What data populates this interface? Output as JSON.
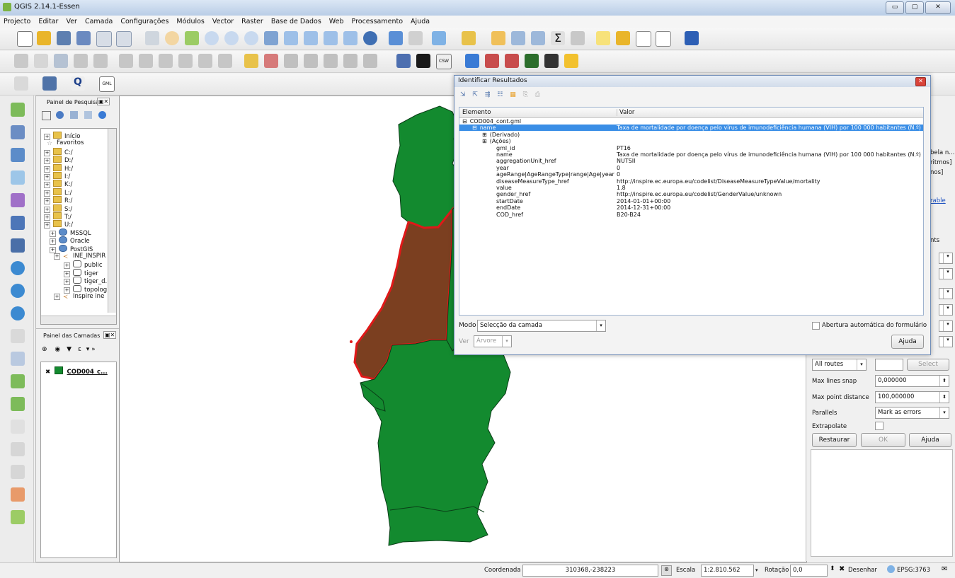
{
  "window": {
    "title": "QGIS 2.14.1-Essen",
    "buttons": [
      "▭",
      "▢",
      "✕"
    ]
  },
  "menu": [
    "Projecto",
    "Editar",
    "Ver",
    "Camada",
    "Configurações",
    "Módulos",
    "Vector",
    "Raster",
    "Base de Dados",
    "Web",
    "Processamento",
    "Ajuda"
  ],
  "browser_panel": {
    "title": "Painel de Pesquisar",
    "items": [
      {
        "label": "Início",
        "type": "folder"
      },
      {
        "label": "Favoritos",
        "type": "star"
      },
      {
        "label": "C:/",
        "type": "folder"
      },
      {
        "label": "D:/",
        "type": "folder"
      },
      {
        "label": "H:/",
        "type": "folder"
      },
      {
        "label": "I:/",
        "type": "folder"
      },
      {
        "label": "K:/",
        "type": "folder"
      },
      {
        "label": "L:/",
        "type": "folder"
      },
      {
        "label": "R:/",
        "type": "folder"
      },
      {
        "label": "S:/",
        "type": "folder"
      },
      {
        "label": "T:/",
        "type": "folder"
      },
      {
        "label": "U:/",
        "type": "folder"
      },
      {
        "label": "MSSQL",
        "type": "db"
      },
      {
        "label": "Oracle",
        "type": "db"
      },
      {
        "label": "PostGIS",
        "type": "db"
      },
      {
        "label": "INE_INSPIR",
        "type": "conn"
      },
      {
        "label": "public",
        "type": "schema"
      },
      {
        "label": "tiger",
        "type": "schema"
      },
      {
        "label": "tiger_d...",
        "type": "schema"
      },
      {
        "label": "topolog...",
        "type": "schema"
      },
      {
        "label": "Inspire ine",
        "type": "conn"
      }
    ]
  },
  "layers_panel": {
    "title": "Painel das Camadas",
    "layer": "COD004_c..."
  },
  "identify_dialog": {
    "title": "Identificar Resultados",
    "col_element": "Elemento",
    "col_value": "Valor",
    "rows": [
      {
        "key": "COD004_cont.gml",
        "value": "",
        "indent": 0,
        "expander": "⊟"
      },
      {
        "key": "name",
        "value": "Taxa de mortalidade por doença pelo vírus de imunodeficiência humana (VIH) por 100 000 habitantes (N.º)",
        "indent": 1,
        "expander": "⊟",
        "selected": true
      },
      {
        "key": "(Derivado)",
        "value": "",
        "indent": 2,
        "expander": "⊞"
      },
      {
        "key": "(Ações)",
        "value": "",
        "indent": 2,
        "expander": "⊞"
      },
      {
        "key": "gml_id",
        "value": "PT16",
        "indent": 2,
        "expander": ""
      },
      {
        "key": "name",
        "value": "Taxa de mortalidade por doença pelo vírus de imunodeficiência humana (VIH) por 100 000 habitantes (N.º)",
        "indent": 2,
        "expander": ""
      },
      {
        "key": "aggregationUnit_href",
        "value": "NUTSII",
        "indent": 2,
        "expander": ""
      },
      {
        "key": "year",
        "value": "0",
        "indent": 2,
        "expander": ""
      },
      {
        "key": "ageRange|AgeRangeType|range|Age|year",
        "value": "0",
        "indent": 2,
        "expander": ""
      },
      {
        "key": "diseaseMeasureType_href",
        "value": "http://inspire.ec.europa.eu/codelist/DiseaseMeasureTypeValue/mortality",
        "indent": 2,
        "expander": ""
      },
      {
        "key": "value",
        "value": "1.8",
        "indent": 2,
        "expander": ""
      },
      {
        "key": "gender_href",
        "value": "http://inspire.ec.europa.eu/codelist/GenderValue/unknown",
        "indent": 2,
        "expander": ""
      },
      {
        "key": "startDate",
        "value": "2014-01-01+00:00",
        "indent": 2,
        "expander": ""
      },
      {
        "key": "endDate",
        "value": "2014-12-31+00:00",
        "indent": 2,
        "expander": ""
      },
      {
        "key": "COD_href",
        "value": "B20-B24",
        "indent": 2,
        "expander": ""
      }
    ],
    "mode_label": "Modo",
    "mode_value": "Selecção da camada",
    "view_label": "Ver",
    "view_value": "Árvore",
    "autoopen_label": "Abertura automática do formulário",
    "help_button": "Ajuda"
  },
  "right_dock": {
    "partial_texts": [
      "bela n...",
      "ritmos]",
      "nos]",
      "rable",
      "nts"
    ],
    "routes_value": "All routes",
    "select_button": "Select",
    "fields": [
      {
        "label": "Max lines snap",
        "value": "0,000000"
      },
      {
        "label": "Max point distance",
        "value": "100,000000"
      },
      {
        "label": "Parallels",
        "value": "Mark as errors"
      },
      {
        "label": "Extrapolate",
        "value": ""
      }
    ],
    "restore_button": "Restaurar",
    "ok_button": "OK",
    "help_button": "Ajuda"
  },
  "status_bar": {
    "coord_label": "Coordenada",
    "coord_value": "310368,-238223",
    "scale_label": "Escala",
    "scale_value": "1:2.810.562",
    "rotation_label": "Rotação",
    "rotation_value": "0,0",
    "render_label": "Desenhar",
    "crs": "EPSG:3763"
  },
  "colors": {
    "region_green": "#138a2f",
    "region_brown": "#7b3f20",
    "selection_red": "#e01818",
    "selection_blue": "#3a8ee6"
  }
}
